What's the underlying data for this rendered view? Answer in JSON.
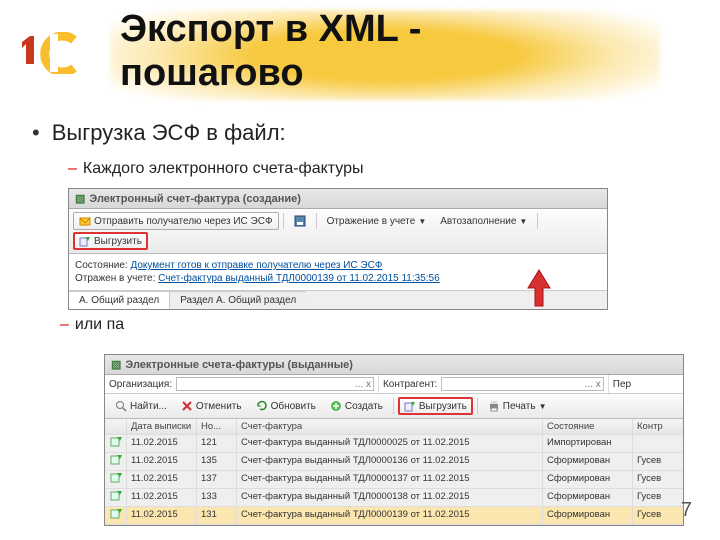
{
  "title_line1": "Экспорт в XML -",
  "title_line2": "пошагово",
  "bullet1": "Выгрузка ЭСФ в файл:",
  "sub1": "Каждого электронного счета-фактуры",
  "sub2_visible": "или па",
  "page_number": "7",
  "ss1": {
    "window_title": "Электронный счет-фактура (создание)",
    "btn_send": "Отправить получателю через ИС ЭСФ",
    "btn_reflect": "Отражение в учете",
    "btn_autofill": "Автозаполнение",
    "btn_export": "Выгрузить",
    "status_label": "Состояние:",
    "status_link": "Документ готов к отправке получателю через ИС ЭСФ",
    "reflect_label": "Отражен в учете:",
    "reflect_link": "Счет-фактура выданный ТДЛ0000139 от 11.02.2015 11:35:56",
    "tab_a": "А. Общий раздел",
    "tab_b": "Раздел А. Общий раздел"
  },
  "ss2": {
    "window_title": "Электронные счета-фактуры (выданные)",
    "lbl_org": "Организация:",
    "lbl_contr": "Контрагент:",
    "lbl_period": "Пер",
    "inp_dots": "... x",
    "tb_find": "Найти...",
    "tb_cancel": "Отменить",
    "tb_refresh": "Обновить",
    "tb_create": "Создать",
    "tb_export": "Выгрузить",
    "tb_print": "Печать",
    "head_date": "Дата выписки",
    "head_num": "Но...",
    "head_sf": "Счет-фактура",
    "head_status": "Состояние",
    "head_ktr": "Контр",
    "rows": [
      {
        "date": "11.02.2015",
        "num": "121",
        "sf": "Счет-фактура выданный ТДЛ0000025 от 11.02.2015",
        "status": "Импортирован",
        "ktr": ""
      },
      {
        "date": "11.02.2015",
        "num": "135",
        "sf": "Счет-фактура выданный ТДЛ0000136 от 11.02.2015",
        "status": "Сформирован",
        "ktr": "Гусев"
      },
      {
        "date": "11.02.2015",
        "num": "137",
        "sf": "Счет-фактура выданный ТДЛ0000137 от 11.02.2015",
        "status": "Сформирован",
        "ktr": "Гусев"
      },
      {
        "date": "11.02.2015",
        "num": "133",
        "sf": "Счет-фактура выданный ТДЛ0000138 от 11.02.2015",
        "status": "Сформирован",
        "ktr": "Гусев"
      },
      {
        "date": "11.02.2015",
        "num": "131",
        "sf": "Счет-фактура выданный ТДЛ0000139 от 11.02.2015",
        "status": "Сформирован",
        "ktr": "Гусев"
      }
    ]
  }
}
